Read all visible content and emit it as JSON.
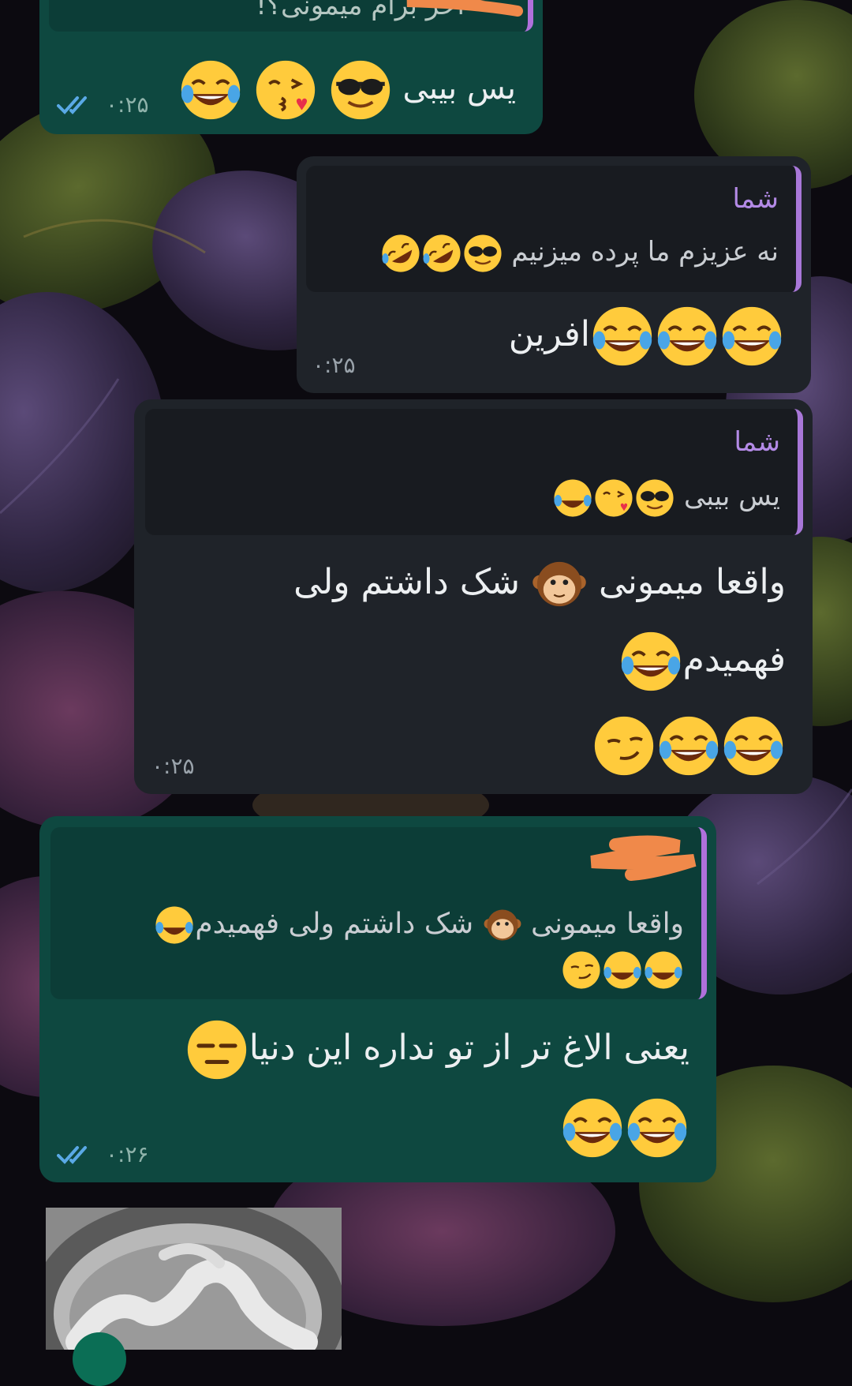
{
  "app": {
    "name": "Telegram-style chat"
  },
  "colors": {
    "outgoing_bubble": "#0e4840",
    "incoming_bubble": "#1f2329",
    "reply_bar": "#a877d8",
    "reply_author": "#b38ae6",
    "ticks": "#5aa9e6"
  },
  "messages": [
    {
      "direction": "outgoing",
      "reply": {
        "author": "",
        "text": "آخر برام میمونی؟!"
      },
      "text": "یس بیبی",
      "emojis": [
        "sunglasses-emoji",
        "kiss-emoji",
        "tears-of-joy-emoji"
      ],
      "time": "۰:۲۵",
      "read": true
    },
    {
      "direction": "incoming",
      "reply": {
        "author": "شما",
        "text": "نه عزیزم ما پرده میزنیم"
      },
      "text": "افرین",
      "time": "۰:۲۵"
    },
    {
      "direction": "incoming",
      "reply": {
        "author": "شما",
        "text": "یس بیبی"
      },
      "text_line1": "واقعا میمونی",
      "text_line1b": "شک داشتم ولی",
      "text_line2": "فهمیدم",
      "time": "۰:۲۵"
    },
    {
      "direction": "outgoing",
      "reply": {
        "author": "",
        "text_a": "واقعا میمونی",
        "text_b": "شک داشتم ولی فهمیدم"
      },
      "text": "یعنی الاغ تر از تو نداره این دنیا",
      "time": "۰:۲۶",
      "read": true
    }
  ]
}
